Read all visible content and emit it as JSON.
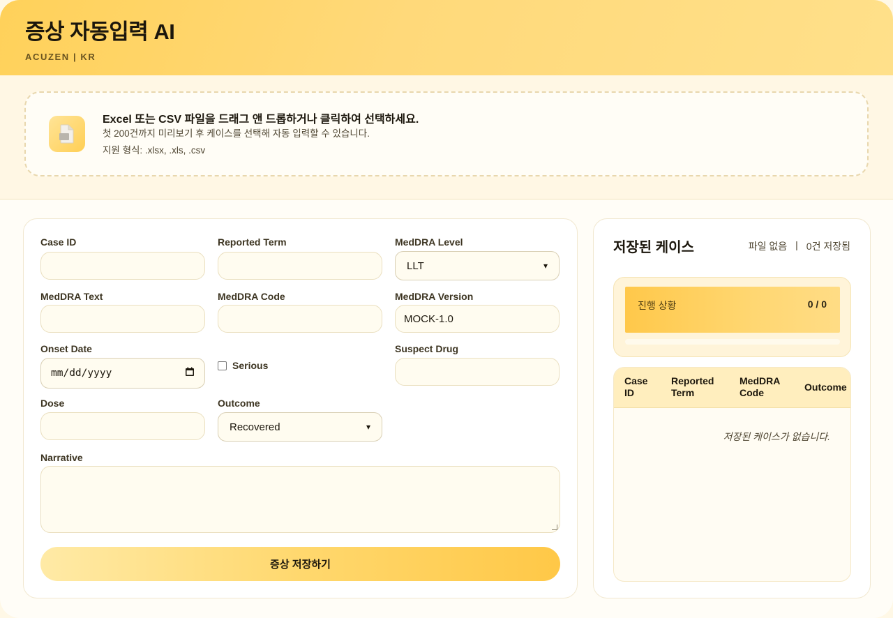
{
  "header": {
    "title": "증상 자동입력 AI",
    "subtitle": "ACUZEN | KR"
  },
  "upload": {
    "main": "Excel 또는 CSV 파일을 드래그 앤 드롭하거나 클릭하여 선택하세요.",
    "sub": "첫 200건까지 미리보기 후 케이스를 선택해 자동 입력할 수 있습니다.",
    "formats": "지원 형식: .xlsx, .xls, .csv",
    "icon": "file-icon"
  },
  "form": {
    "case_id_label": "Case ID",
    "reported_term_label": "Reported Term",
    "meddra_level_label": "MedDRA Level",
    "meddra_level_value": "LLT",
    "meddra_text_label": "MedDRA Text",
    "meddra_code_label": "MedDRA Code",
    "meddra_version_label": "MedDRA Version",
    "meddra_version_value": "MOCK-1.0",
    "onset_date_label": "Onset Date",
    "onset_date_placeholder": "mm/dd/yyyy",
    "serious_label": "Serious",
    "suspect_drug_label": "Suspect Drug",
    "dose_label": "Dose",
    "outcome_label": "Outcome",
    "outcome_value": "Recovered",
    "narrative_label": "Narrative",
    "save_button": "증상 저장하기"
  },
  "side": {
    "title": "저장된 케이스",
    "file_status": "파일 없음",
    "divider": "|",
    "saved_count": "0건 저장됨",
    "progress_label": "진행 상황",
    "progress_value": "0 / 0",
    "table_headers": [
      "Case ID",
      "Reported Term",
      "MedDRA Code",
      "Outcome"
    ],
    "empty_message": "저장된 케이스가 없습니다."
  }
}
